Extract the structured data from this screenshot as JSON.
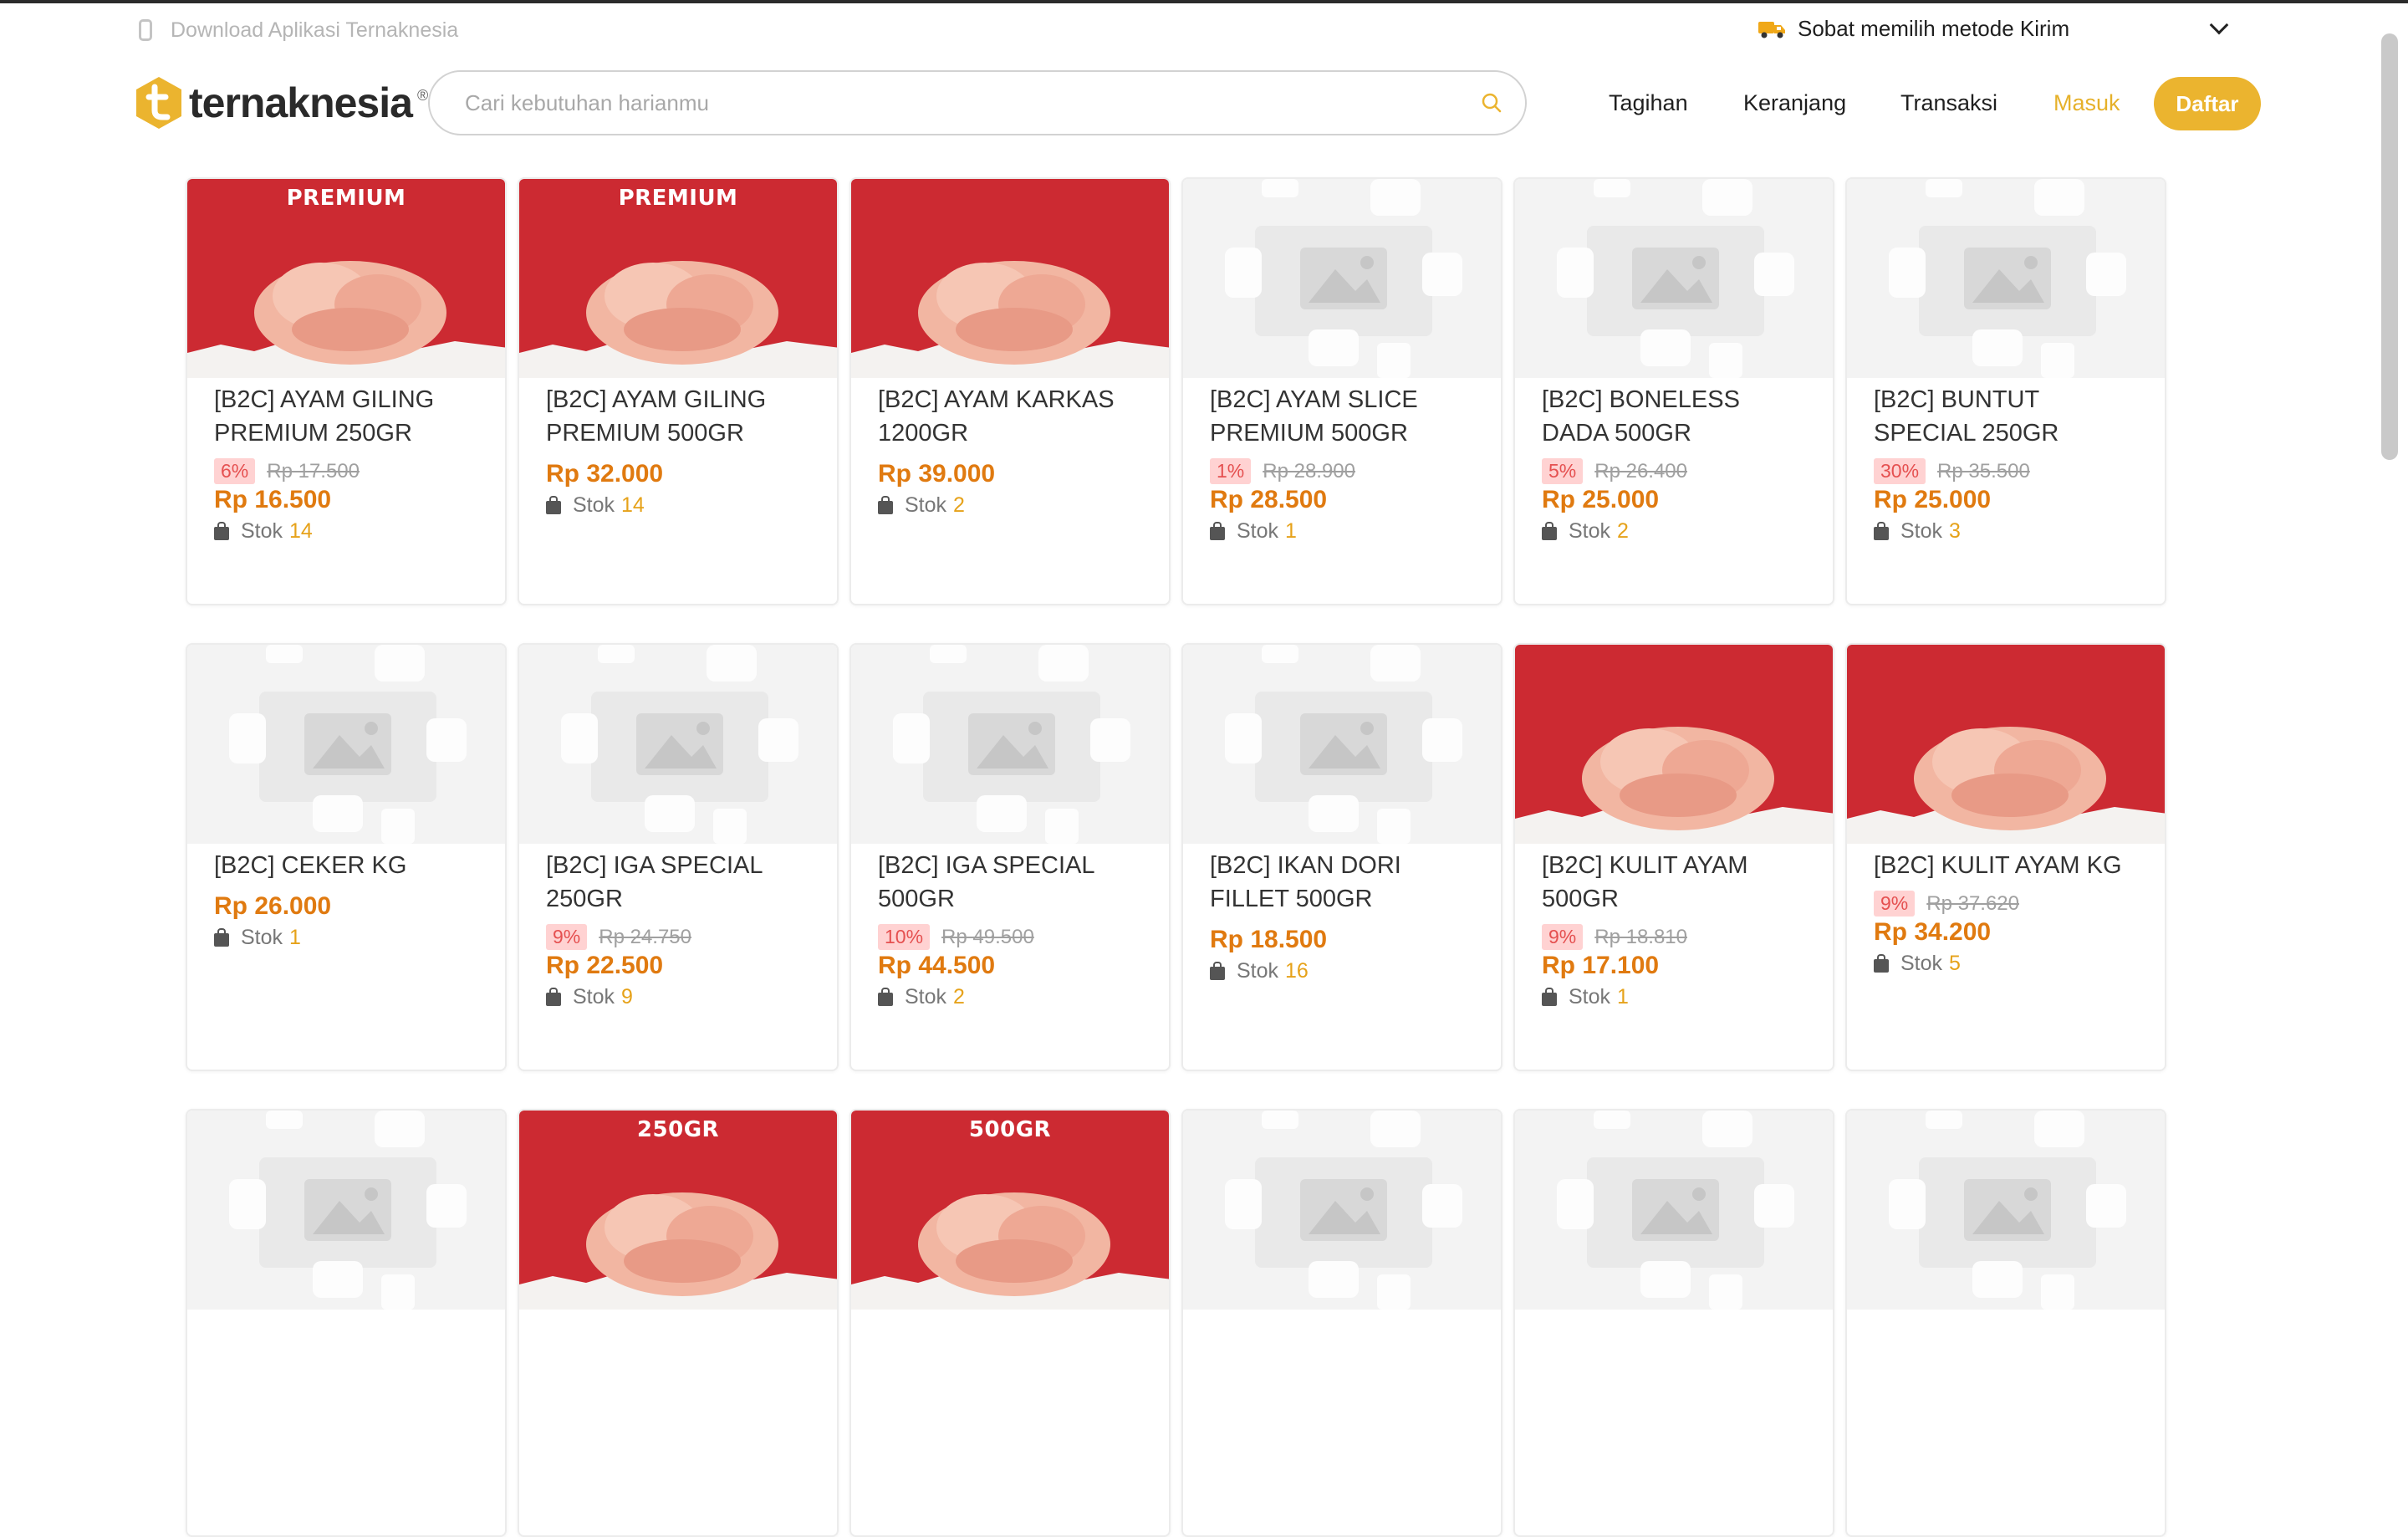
{
  "topbar": {
    "download_text": "Download Aplikasi Ternaknesia",
    "shipping_text": "Sobat memilih metode Kirim"
  },
  "header": {
    "logo_text": "ternaknesia",
    "search_placeholder": "Cari kebutuhan harianmu",
    "nav": [
      "Tagihan",
      "Keranjang",
      "Transaksi",
      "Masuk"
    ],
    "register_label": "Daftar"
  },
  "colors": {
    "accent": "#ebb42f",
    "price": "#e07a10",
    "banner_red": "#cc2a32"
  },
  "products": [
    {
      "name": "[B2C] AYAM GILING PREMIUM 250GR",
      "image": "red",
      "tag": "PREMIUM",
      "discount": "6%",
      "original_price": "Rp 17.500",
      "price": "Rp 16.500",
      "stock_label": "Stok",
      "stock": "14"
    },
    {
      "name": "[B2C] AYAM GILING PREMIUM 500GR",
      "image": "red",
      "tag": "PREMIUM",
      "discount": "",
      "original_price": "",
      "price": "Rp 32.000",
      "stock_label": "Stok",
      "stock": "14"
    },
    {
      "name": "[B2C] AYAM KARKAS 1200GR",
      "image": "red",
      "tag": "",
      "discount": "",
      "original_price": "",
      "price": "Rp 39.000",
      "stock_label": "Stok",
      "stock": "2"
    },
    {
      "name": "[B2C] AYAM SLICE PREMIUM 500GR",
      "image": "placeholder",
      "tag": "",
      "discount": "1%",
      "original_price": "Rp 28.900",
      "price": "Rp 28.500",
      "stock_label": "Stok",
      "stock": "1"
    },
    {
      "name": "[B2C] BONELESS DADA 500GR",
      "image": "placeholder",
      "tag": "",
      "discount": "5%",
      "original_price": "Rp 26.400",
      "price": "Rp 25.000",
      "stock_label": "Stok",
      "stock": "2"
    },
    {
      "name": "[B2C] BUNTUT SPECIAL 250GR",
      "image": "placeholder",
      "tag": "",
      "discount": "30%",
      "original_price": "Rp 35.500",
      "price": "Rp 25.000",
      "stock_label": "Stok",
      "stock": "3"
    },
    {
      "name": "[B2C] CEKER KG",
      "image": "placeholder",
      "tag": "",
      "discount": "",
      "original_price": "",
      "price": "Rp 26.000",
      "stock_label": "Stok",
      "stock": "1"
    },
    {
      "name": "[B2C] IGA SPECIAL 250GR",
      "image": "placeholder",
      "tag": "",
      "discount": "9%",
      "original_price": "Rp 24.750",
      "price": "Rp 22.500",
      "stock_label": "Stok",
      "stock": "9"
    },
    {
      "name": "[B2C] IGA SPECIAL 500GR",
      "image": "placeholder",
      "tag": "",
      "discount": "10%",
      "original_price": "Rp 49.500",
      "price": "Rp 44.500",
      "stock_label": "Stok",
      "stock": "2"
    },
    {
      "name": "[B2C] IKAN DORI FILLET 500GR",
      "image": "placeholder",
      "tag": "",
      "discount": "",
      "original_price": "",
      "price": "Rp 18.500",
      "stock_label": "Stok",
      "stock": "16"
    },
    {
      "name": "[B2C] KULIT AYAM 500GR",
      "image": "red",
      "tag": "",
      "discount": "9%",
      "original_price": "Rp 18.810",
      "price": "Rp 17.100",
      "stock_label": "Stok",
      "stock": "1"
    },
    {
      "name": "[B2C] KULIT AYAM KG",
      "image": "red",
      "tag": "",
      "discount": "9%",
      "original_price": "Rp 37.620",
      "price": "Rp 34.200",
      "stock_label": "Stok",
      "stock": "5"
    },
    {
      "name": "",
      "image": "placeholder",
      "tag": "",
      "discount": "",
      "original_price": "",
      "price": "",
      "stock_label": "",
      "stock": ""
    },
    {
      "name": "",
      "image": "red",
      "tag": "250GR",
      "discount": "",
      "original_price": "",
      "price": "",
      "stock_label": "",
      "stock": ""
    },
    {
      "name": "",
      "image": "red",
      "tag": "500GR",
      "discount": "",
      "original_price": "",
      "price": "",
      "stock_label": "",
      "stock": ""
    },
    {
      "name": "",
      "image": "placeholder",
      "tag": "",
      "discount": "",
      "original_price": "",
      "price": "",
      "stock_label": "",
      "stock": ""
    },
    {
      "name": "",
      "image": "placeholder",
      "tag": "",
      "discount": "",
      "original_price": "",
      "price": "",
      "stock_label": "",
      "stock": ""
    },
    {
      "name": "",
      "image": "placeholder",
      "tag": "",
      "discount": "",
      "original_price": "",
      "price": "",
      "stock_label": "",
      "stock": ""
    }
  ]
}
